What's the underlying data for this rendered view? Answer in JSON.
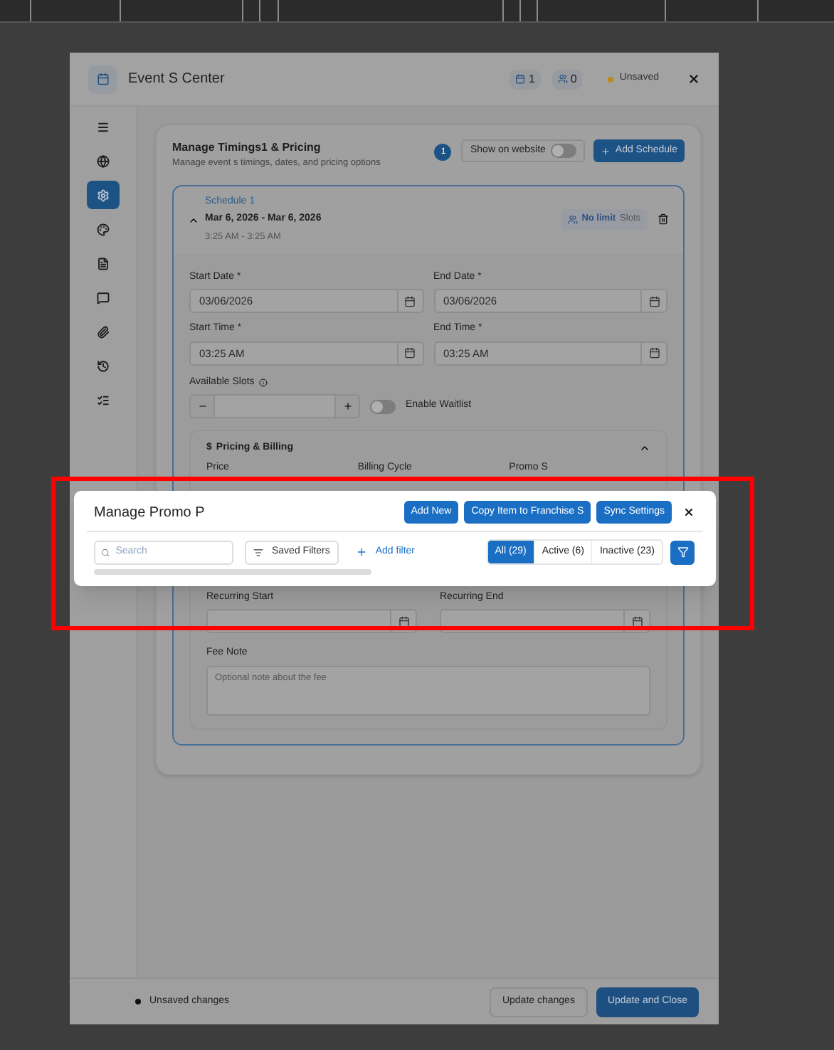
{
  "window": {
    "title": "Event S Center",
    "badges": [
      {
        "kind": "calendar",
        "count": "1"
      },
      {
        "kind": "people",
        "count": "0"
      }
    ],
    "status": "Unsaved"
  },
  "sidebar": {
    "items": [
      {
        "kind": "menu",
        "selected": false
      },
      {
        "kind": "globe",
        "selected": false
      },
      {
        "kind": "gear",
        "selected": true
      },
      {
        "kind": "palette",
        "selected": false
      },
      {
        "kind": "file",
        "selected": false
      },
      {
        "kind": "chat",
        "selected": false
      },
      {
        "kind": "paperclip",
        "selected": false
      },
      {
        "kind": "history",
        "selected": false
      },
      {
        "kind": "checklist",
        "selected": false
      }
    ]
  },
  "section": {
    "title": "Manage Timings1 & Pricing",
    "subtitle": "Manage event s timings, dates, and pricing options",
    "count": "1",
    "toggle": {
      "label": "Show on website",
      "on": false
    },
    "add_button": "Add Schedule"
  },
  "schedule": {
    "name": "Schedule 1",
    "dates": "Mar 6, 2026 - Mar 6, 2026",
    "times": "3:25 AM - 3:25 AM",
    "expanded": true,
    "slots": {
      "value": "No limit",
      "unit": "Slots"
    },
    "fields": [
      {
        "label": "Start Date *",
        "value": "03/06/2026"
      },
      {
        "label": "End Date *",
        "value": "03/06/2026"
      },
      {
        "label": "Start Time *",
        "value": "03:25 AM"
      },
      {
        "label": "End Time *",
        "value": "03:25 AM"
      }
    ],
    "available_slots": {
      "label": "Available Slots"
    },
    "waitlist": {
      "label": "Enable Waitlist",
      "on": false
    },
    "pricing": {
      "currency": "$",
      "title": "Pricing & Billing",
      "expanded": true,
      "columns": [
        "Price",
        "Billing Cycle",
        "Promo S"
      ],
      "recurring": [
        "Recurring Start",
        "Recurring End"
      ],
      "fee_note": {
        "label": "Fee Note",
        "placeholder": "Optional note about the fee"
      }
    }
  },
  "footer": {
    "status": "Unsaved changes",
    "buttons": [
      {
        "label": "Update changes",
        "kind": "secondary"
      },
      {
        "label": "Update and Close",
        "kind": "primary"
      }
    ]
  },
  "popup": {
    "title": "Manage Promo P",
    "actions": [
      "Add New",
      "Copy Item to Franchise S",
      "Sync Settings"
    ],
    "search": {
      "placeholder": "Search"
    },
    "saved_filters": "Saved Filters",
    "add_filter": "Add filter",
    "tabs": [
      {
        "label": "All (29)",
        "selected": true
      },
      {
        "label": "Active (6)",
        "selected": false
      },
      {
        "label": "Inactive (23)",
        "selected": false
      }
    ]
  }
}
